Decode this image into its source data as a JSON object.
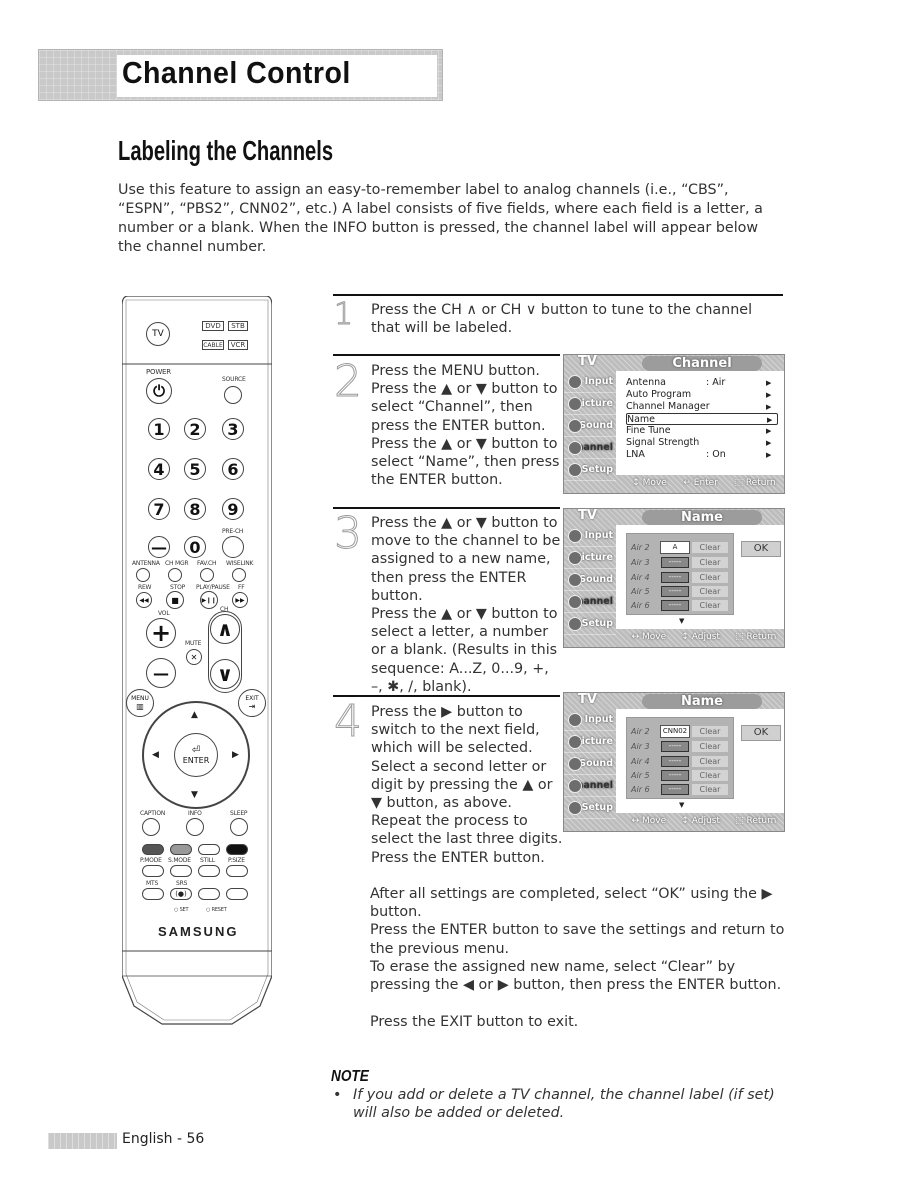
{
  "header": {
    "title": "Channel Control"
  },
  "section": {
    "title": "Labeling the Channels",
    "intro": "Use this feature to assign an easy-to-remember label to analog channels (i.e., “CBS”, “ESPN”, “PBS2”, CNN02”, etc.) A label consists of five fields, where each field is a letter, a number or a blank. When the INFO button is pressed, the channel label will appear below the channel number."
  },
  "steps": [
    {
      "number": "1",
      "text": "Press the CH ∧ or CH ∨ button to tune to the channel that will be labeled."
    },
    {
      "number": "2",
      "text": "Press the MENU button.\nPress the ▲ or ▼ button to select “Channel”, then press the ENTER button.\nPress the ▲ or ▼ button to select “Name”, then press the ENTER button."
    },
    {
      "number": "3",
      "text": "Press the ▲ or ▼ button to move to the channel to be assigned to a new name, then press the ENTER button.\nPress the ▲ or ▼ button to select a letter, a number or a blank. (Results in this sequence: A...Z, 0...9, +, –, ✱, /, blank)."
    },
    {
      "number": "4",
      "text": "Press the ▶ button to switch to the next field, which will be selected.\nSelect a second letter or digit by pressing the ▲ or ▼ button, as above.\nRepeat the process to select the last three digits.\nPress the ENTER button."
    }
  ],
  "after_steps": [
    "After all settings are completed, select “OK” using the ▶ button.\nPress the ENTER button to save the settings and return to the previous menu.",
    "To erase the assigned new name, select “Clear” by pressing the ◀ or ▶ button, then press the ENTER button.",
    "Press the EXIT button to exit."
  ],
  "note": {
    "title": "NOTE",
    "bullet": "•",
    "text": "If you add or delete a TV channel, the channel label (if set) will also be added or deleted."
  },
  "footer": {
    "page": "English - 56"
  },
  "osd": {
    "tv_label": "TV",
    "side_items": [
      "Input",
      "Picture",
      "Sound",
      "Channel",
      "Setup"
    ],
    "channel_screen": {
      "title": "Channel",
      "items": [
        {
          "label": "Antenna",
          "value": ": Air",
          "arrow": "▶"
        },
        {
          "label": "Auto Program",
          "value": "",
          "arrow": "▶"
        },
        {
          "label": "Channel Manager",
          "value": "",
          "arrow": "▶"
        },
        {
          "label": "Name",
          "value": "",
          "arrow": "▶",
          "selected": true
        },
        {
          "label": "Fine Tune",
          "value": "",
          "arrow": "▶"
        },
        {
          "label": "Signal Strength",
          "value": "",
          "arrow": "▶"
        },
        {
          "label": "LNA",
          "value": ": On",
          "arrow": "▶"
        }
      ],
      "footer": [
        "↕ Move",
        "↵ Enter",
        "⬚ Return"
      ]
    },
    "name_screen_1": {
      "title": "Name",
      "rows": [
        {
          "channel": "Air  2",
          "field": "A",
          "clear": "Clear",
          "active": true
        },
        {
          "channel": "Air  3",
          "field": "-----",
          "clear": "Clear"
        },
        {
          "channel": "Air  4",
          "field": "-----",
          "clear": "Clear"
        },
        {
          "channel": "Air  5",
          "field": "-----",
          "clear": "Clear"
        },
        {
          "channel": "Air  6",
          "field": "-----",
          "clear": "Clear"
        }
      ],
      "ok": "OK",
      "footer": [
        "↔ Move",
        "↕ Adjust",
        "⬚ Return"
      ]
    },
    "name_screen_2": {
      "title": "Name",
      "rows": [
        {
          "channel": "Air  2",
          "field": "CNN02",
          "clear": "Clear",
          "active": true
        },
        {
          "channel": "Air  3",
          "field": "-----",
          "clear": "Clear"
        },
        {
          "channel": "Air  4",
          "field": "-----",
          "clear": "Clear"
        },
        {
          "channel": "Air  5",
          "field": "-----",
          "clear": "Clear"
        },
        {
          "channel": "Air  6",
          "field": "-----",
          "clear": "Clear"
        }
      ],
      "ok": "OK",
      "footer": [
        "↔ Move",
        "↕ Adjust",
        "⬚ Return"
      ]
    }
  },
  "remote": {
    "tv": "TV",
    "dvd": "DVD",
    "stb": "STB",
    "cable": "CABLE",
    "vcr": "VCR",
    "power": "POWER",
    "source": "SOURCE",
    "digits": [
      "1",
      "2",
      "3",
      "4",
      "5",
      "6",
      "7",
      "8",
      "9"
    ],
    "zero": "0",
    "dash": "—",
    "prech": "PRE-CH",
    "row_labels": [
      "ANTENNA",
      "CH MGR",
      "FAV.CH",
      "WISELINK"
    ],
    "transport_labels": [
      "REW",
      "STOP",
      "PLAY/PAUSE",
      "FF"
    ],
    "transport_icons": [
      "◀◀",
      "■",
      "▶❙❙",
      "▶▶"
    ],
    "vol": "VOL",
    "ch": "CH",
    "mute": "MUTE",
    "plus": "+",
    "minus": "—",
    "ch_up": "∧",
    "ch_down": "∨",
    "menu": "MENU",
    "exit": "EXIT",
    "enter": "ENTER",
    "up": "▲",
    "down": "▼",
    "left": "◀",
    "right": "▶",
    "func_labels": [
      "CAPTION",
      "INFO",
      "SLEEP"
    ],
    "mode_labels": [
      "P.MODE",
      "S.MODE",
      "STILL",
      "P.SIZE"
    ],
    "mts": "MTS",
    "srs": "SRS",
    "set": "SET",
    "reset": "RESET",
    "brand": "SAMSUNG"
  }
}
